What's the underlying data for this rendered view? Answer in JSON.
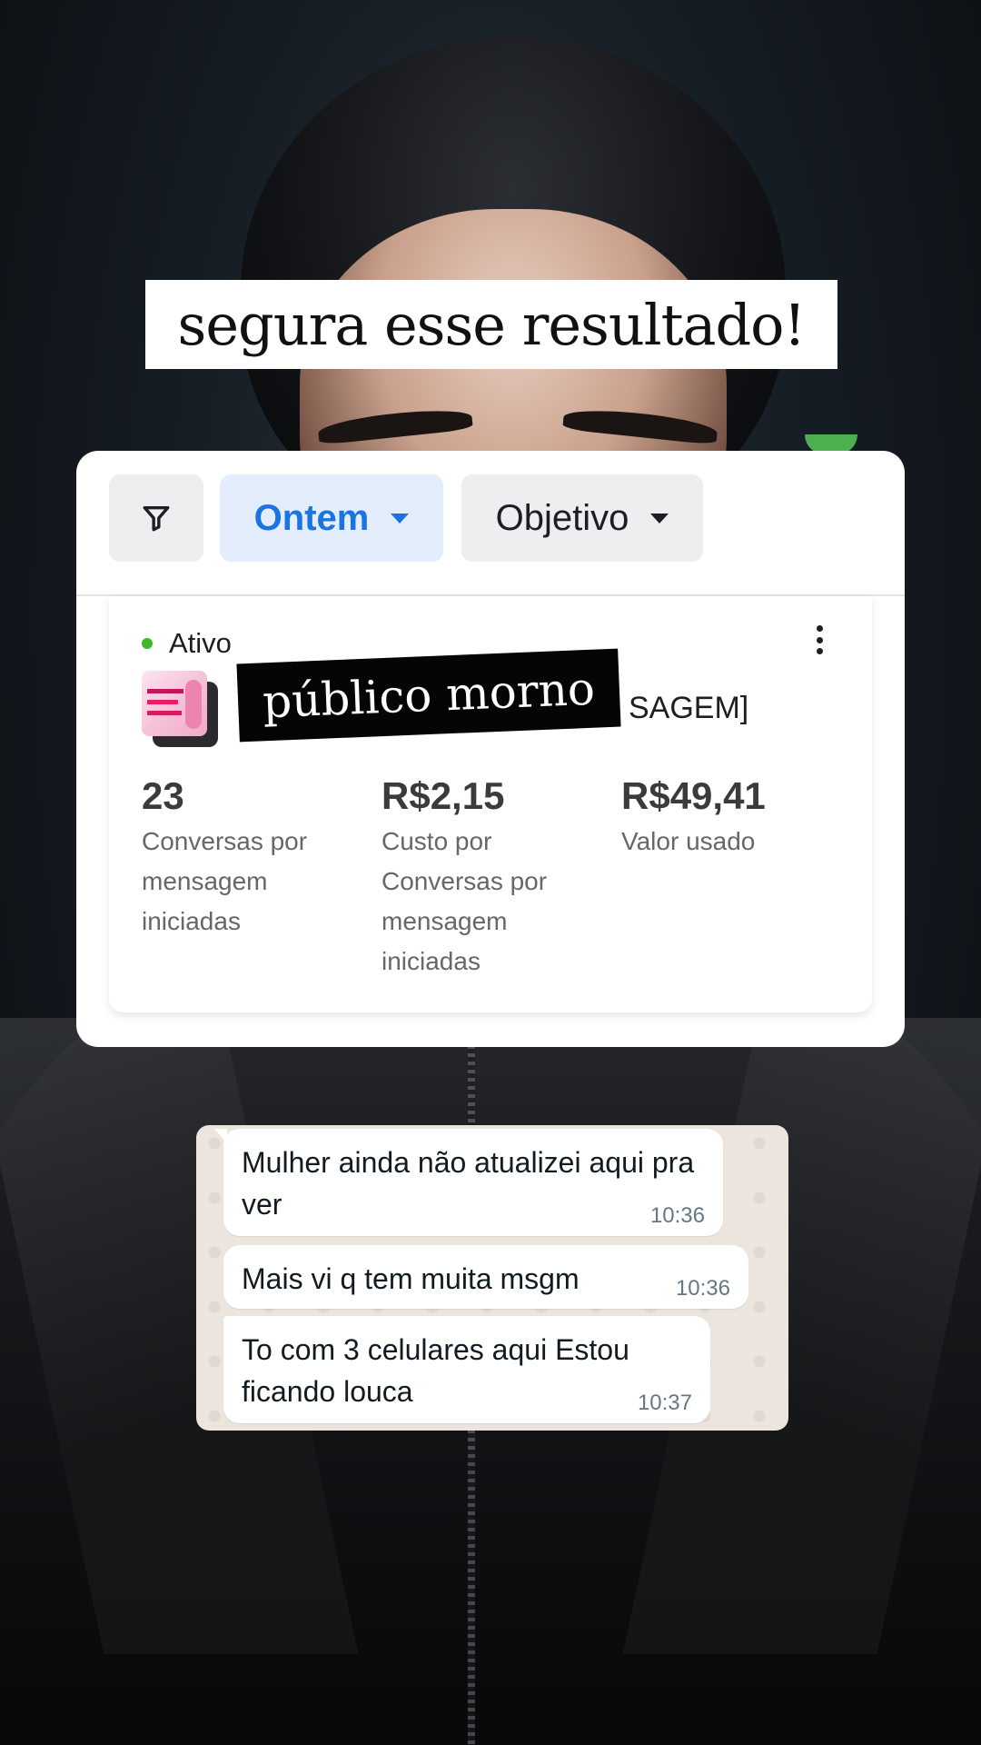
{
  "headline": "segura esse resultado!",
  "filters": {
    "date_label": "Ontem",
    "objective_label": "Objetivo"
  },
  "campaign": {
    "status": "Ativo",
    "name_visible": "SAGEM]",
    "sticker": "público morno"
  },
  "metrics": [
    {
      "value": "23",
      "label": "Conversas por mensagem iniciadas"
    },
    {
      "value": "R$2,15",
      "label": "Custo por Conversas por mensagem iniciadas"
    },
    {
      "value": "R$49,41",
      "label": "Valor usado"
    }
  ],
  "chat": {
    "messages": [
      {
        "text": "Mulher ainda não atualizei aqui pra ver",
        "time": "10:36"
      },
      {
        "text": "Mais vi q tem muita msgm",
        "time": "10:36"
      },
      {
        "text": "To com 3 celulares aqui Estou ficando louca",
        "time": "10:37"
      }
    ]
  },
  "colors": {
    "accent": "#1b74e4",
    "status_active": "#42b72a",
    "chat_background": "#ece5dd"
  },
  "icons": [
    "filter-icon",
    "caret-down-icon",
    "more-options-icon",
    "status-dot-icon"
  ]
}
